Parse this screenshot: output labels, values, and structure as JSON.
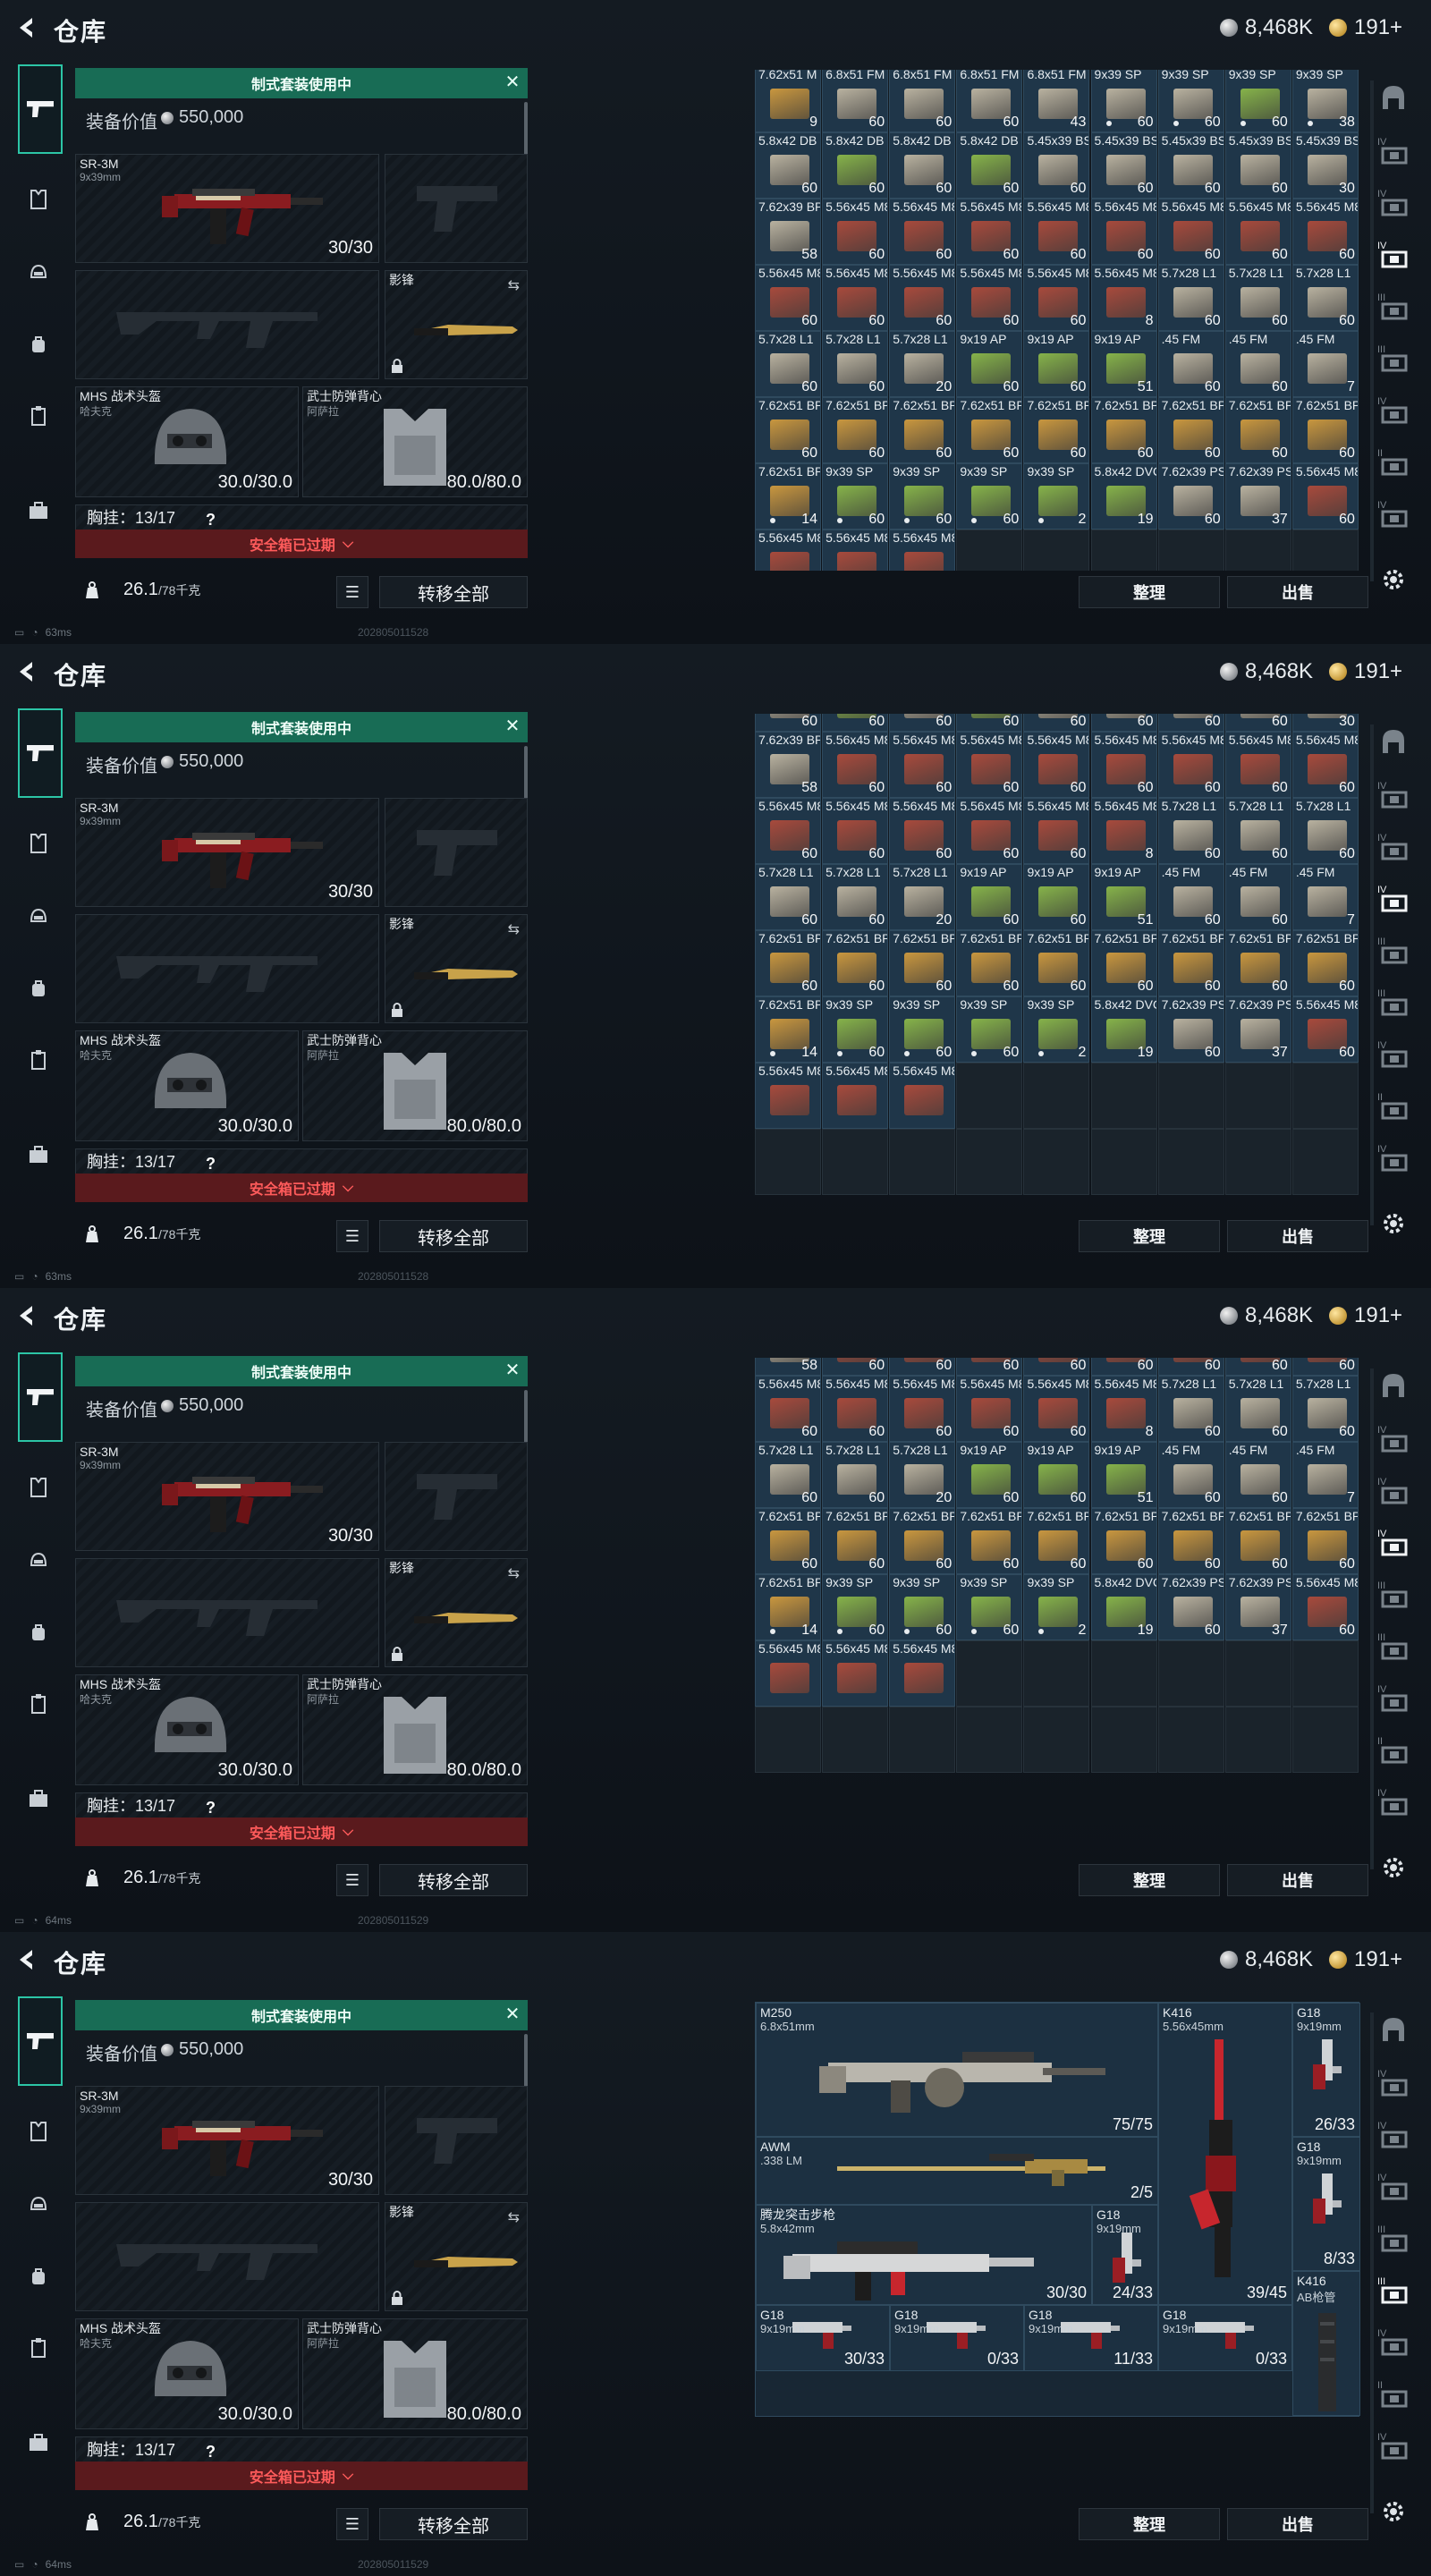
{
  "header": {
    "title": "仓库",
    "silver": "8,468K",
    "gold": "191+"
  },
  "loadout": {
    "banner": "制式套装使用中",
    "equip_label": "装备价值",
    "equip_value": "550,000",
    "primary": {
      "name": "SR-3M",
      "caliber": "9x39mm",
      "ammo": "30/30"
    },
    "knife_name": "影锋",
    "helmet": {
      "name": "MHS 战术头盔",
      "sub": "哈夫克",
      "durability": "30.0/30.0"
    },
    "vest": {
      "name": "武士防弹背心",
      "sub": "阿萨拉",
      "durability": "80.0/80.0"
    },
    "chest_label": "胸挂：13/17",
    "chest_q": "?",
    "safe_expired": "安全箱已过期",
    "weight": "26.1",
    "weight_max": "/78千克",
    "transfer_all": "转移全部"
  },
  "buttons": {
    "sort": "整理",
    "sell": "出售"
  },
  "status": [
    {
      "ping": "63ms",
      "build": "202805011528"
    },
    {
      "ping": "63ms",
      "build": "202805011528"
    },
    {
      "ping": "64ms",
      "build": "202805011529"
    },
    {
      "ping": "64ms",
      "build": "202805011529"
    }
  ],
  "panel1_cells": [
    {
      "cal": "7.62x51 M",
      "num": "9",
      "color": "#c9973f"
    },
    {
      "cal": "6.8x51 FM",
      "num": "60",
      "color": "#b9b2a0"
    },
    {
      "cal": "6.8x51 FM",
      "num": "60",
      "color": "#b9b2a0"
    },
    {
      "cal": "6.8x51 FM",
      "num": "60",
      "color": "#b9b2a0"
    },
    {
      "cal": "6.8x51 FM",
      "num": "43",
      "color": "#b9b2a0"
    },
    {
      "cal": "9x39 SP",
      "num": "60",
      "dot": true,
      "color": "#b9b2a0"
    },
    {
      "cal": "9x39 SP",
      "num": "60",
      "dot": true,
      "color": "#b9b2a0"
    },
    {
      "cal": "9x39 SP",
      "num": "60",
      "dot": true,
      "color": "#86b34a"
    },
    {
      "cal": "9x39 SP",
      "num": "38",
      "dot": true,
      "color": "#b9b2a0"
    },
    {
      "cal": "5.8x42 DB",
      "num": "60",
      "color": "#b9b2a0"
    },
    {
      "cal": "5.8x42 DB",
      "num": "60",
      "color": "#86b34a"
    },
    {
      "cal": "5.8x42 DB",
      "num": "60",
      "color": "#b9b2a0"
    },
    {
      "cal": "5.8x42 DB",
      "num": "60",
      "color": "#86b34a"
    },
    {
      "cal": "5.45x39 BS",
      "num": "60",
      "color": "#b9b2a0"
    },
    {
      "cal": "5.45x39 BS",
      "num": "60",
      "color": "#b9b2a0"
    },
    {
      "cal": "5.45x39 BS",
      "num": "60",
      "color": "#b9b2a0"
    },
    {
      "cal": "5.45x39 BS",
      "num": "60",
      "color": "#b9b2a0"
    },
    {
      "cal": "5.45x39 BS",
      "num": "30",
      "color": "#b9b2a0"
    },
    {
      "cal": "7.62x39 BP",
      "num": "58",
      "color": "#b9b2a0"
    },
    {
      "cal": "5.56x45 M855A1",
      "num": "60",
      "color": "#a84a3c"
    },
    {
      "cal": "5.56x45 M855A1",
      "num": "60",
      "color": "#a84a3c"
    },
    {
      "cal": "5.56x45 M855A1",
      "num": "60",
      "color": "#a84a3c"
    },
    {
      "cal": "5.56x45 M855A1",
      "num": "60",
      "color": "#a84a3c"
    },
    {
      "cal": "5.56x45 M855A1",
      "num": "60",
      "color": "#a84a3c"
    },
    {
      "cal": "5.56x45 M855A1",
      "num": "60",
      "color": "#a84a3c"
    },
    {
      "cal": "5.56x45 M855A1",
      "num": "60",
      "color": "#a84a3c"
    },
    {
      "cal": "5.56x45 M855A1",
      "num": "60",
      "color": "#a84a3c"
    },
    {
      "cal": "5.56x45 M855A1",
      "num": "60",
      "color": "#a84a3c"
    },
    {
      "cal": "5.56x45 M855A1",
      "num": "60",
      "color": "#a84a3c"
    },
    {
      "cal": "5.56x45 M855A1",
      "num": "60",
      "color": "#a84a3c"
    },
    {
      "cal": "5.56x45 M855A1",
      "num": "60",
      "color": "#a84a3c"
    },
    {
      "cal": "5.56x45 M855A1",
      "num": "60",
      "color": "#a84a3c"
    },
    {
      "cal": "5.56x45 M855A1",
      "num": "8",
      "color": "#a84a3c"
    },
    {
      "cal": "5.7x28 L1",
      "num": "60",
      "color": "#b9b2a0"
    },
    {
      "cal": "5.7x28 L1",
      "num": "60",
      "color": "#b9b2a0"
    },
    {
      "cal": "5.7x28 L1",
      "num": "60",
      "color": "#b9b2a0"
    },
    {
      "cal": "5.7x28 L1",
      "num": "60",
      "color": "#b9b2a0"
    },
    {
      "cal": "5.7x28 L1",
      "num": "60",
      "color": "#b9b2a0"
    },
    {
      "cal": "5.7x28 L1",
      "num": "20",
      "color": "#b9b2a0"
    },
    {
      "cal": "9x19 AP",
      "num": "60",
      "color": "#86b34a"
    },
    {
      "cal": "9x19 AP",
      "num": "60",
      "color": "#86b34a"
    },
    {
      "cal": "9x19 AP",
      "num": "51",
      "color": "#86b34a"
    },
    {
      "cal": ".45 FM",
      "num": "60",
      "color": "#b9b2a0"
    },
    {
      "cal": ".45 FM",
      "num": "60",
      "color": "#b9b2a0"
    },
    {
      "cal": ".45 FM",
      "num": "7",
      "color": "#b9b2a0"
    },
    {
      "cal": "7.62x51 BP",
      "num": "60",
      "color": "#c9973f"
    },
    {
      "cal": "7.62x51 BP",
      "num": "60",
      "color": "#c9973f"
    },
    {
      "cal": "7.62x51 BP",
      "num": "60",
      "color": "#c9973f"
    },
    {
      "cal": "7.62x51 BP",
      "num": "60",
      "color": "#c9973f"
    },
    {
      "cal": "7.62x51 BP",
      "num": "60",
      "color": "#c9973f"
    },
    {
      "cal": "7.62x51 BP",
      "num": "60",
      "color": "#c9973f"
    },
    {
      "cal": "7.62x51 BP",
      "num": "60",
      "color": "#c9973f"
    },
    {
      "cal": "7.62x51 BP",
      "num": "60",
      "color": "#c9973f"
    },
    {
      "cal": "7.62x51 BP",
      "num": "60",
      "color": "#c9973f"
    },
    {
      "cal": "7.62x51 BP",
      "num": "14",
      "dot": true,
      "color": "#c9973f"
    },
    {
      "cal": "9x39 SP",
      "num": "60",
      "dot": true,
      "color": "#86b34a"
    },
    {
      "cal": "9x39 SP",
      "num": "60",
      "dot": true,
      "color": "#86b34a"
    },
    {
      "cal": "9x39 SP",
      "num": "60",
      "dot": true,
      "color": "#86b34a"
    },
    {
      "cal": "9x39 SP",
      "num": "2",
      "dot": true,
      "color": "#86b34a"
    },
    {
      "cal": "5.8x42 DVC",
      "num": "19",
      "color": "#86b34a"
    },
    {
      "cal": "7.62x39 PS",
      "num": "60",
      "color": "#b9b2a0"
    },
    {
      "cal": "7.62x39 PS",
      "num": "37",
      "color": "#b9b2a0"
    },
    {
      "cal": "5.56x45 M855",
      "num": "60",
      "color": "#a84a3c"
    },
    {
      "cal": "5.56x45 M855",
      "num": "",
      "color": "#a84a3c"
    },
    {
      "cal": "5.56x45 M855",
      "num": "",
      "color": "#a84a3c"
    },
    {
      "cal": "5.56x45 M855",
      "num": "",
      "color": "#a84a3c"
    }
  ],
  "weapons": [
    {
      "name": "M250",
      "sub": "6.8x51mm",
      "val": "75/75"
    },
    {
      "name": "K416",
      "sub": "5.56x45mm",
      "val": "39/45"
    },
    {
      "name": "G18",
      "sub": "9x19mm",
      "val": "26/33"
    },
    {
      "name": "AWM",
      "sub": ".338 LM",
      "val": "2/5"
    },
    {
      "name": "G18",
      "sub": "9x19mm",
      "val": "8/33"
    },
    {
      "name": "腾龙突击步枪",
      "sub": "5.8x42mm",
      "val": "30/30"
    },
    {
      "name": "G18",
      "sub": "9x19mm",
      "val": "24/33"
    },
    {
      "name": "K416",
      "sub": "AB枪管",
      "val": ""
    },
    {
      "name": "G18",
      "sub": "9x19mm",
      "val": "30/33"
    },
    {
      "name": "G18",
      "sub": "9x19mm",
      "val": "0/33"
    },
    {
      "name": "G18",
      "sub": "9x19mm",
      "val": "11/33"
    },
    {
      "name": "G18",
      "sub": "9x19mm",
      "val": "0/33"
    }
  ]
}
